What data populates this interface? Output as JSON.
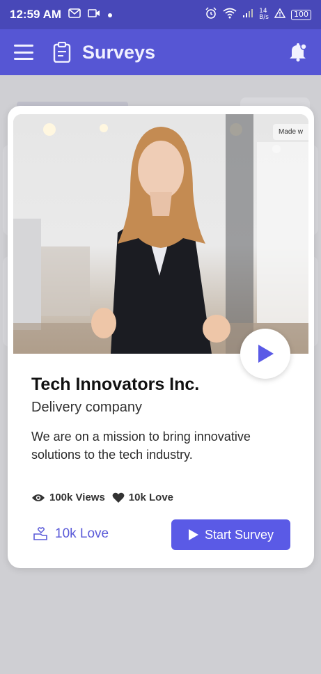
{
  "status_bar": {
    "time": "12:59 AM",
    "net_speed_top": "14",
    "net_speed_unit": "B/s",
    "battery": "100"
  },
  "app_bar": {
    "title": "Surveys"
  },
  "card": {
    "badge_text": "Made w",
    "company_name": "Tech Innovators Inc.",
    "company_type": "Delivery company",
    "description": "We are on a mission to bring innovative solutions to the tech industry.",
    "views": "100k Views",
    "loves": "10k Love",
    "love_link": "10k Love",
    "start_button": "Start Survey"
  },
  "colors": {
    "status_bar": "#4848b8",
    "app_bar": "#5656d4",
    "accent": "#5a5ae6"
  }
}
